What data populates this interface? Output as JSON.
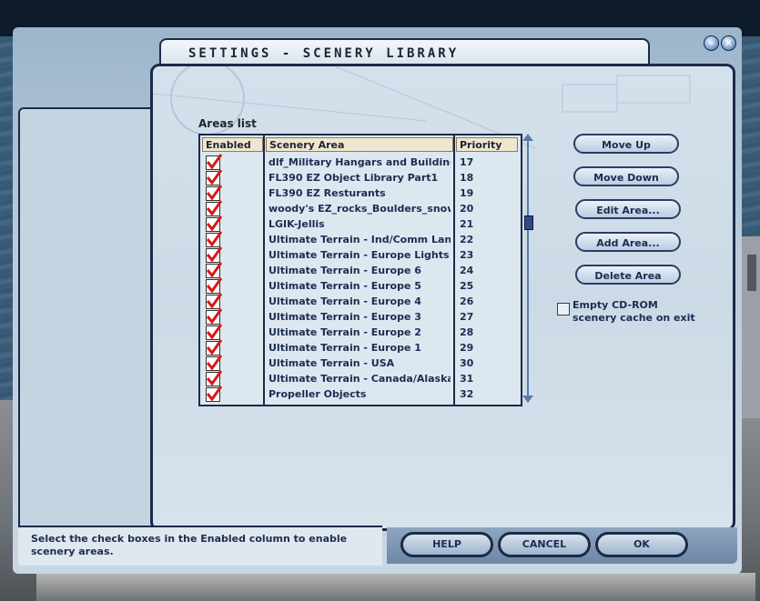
{
  "window": {
    "title": "SETTINGS - SCENERY LIBRARY",
    "minimize_glyph": "–",
    "close_glyph": "✕"
  },
  "areas_list": {
    "label": "Areas list",
    "columns": [
      "Enabled",
      "Scenery Area",
      "Priority"
    ],
    "rows": [
      {
        "enabled": true,
        "name": "dlf_Military Hangars and Buildings Li",
        "priority": "17"
      },
      {
        "enabled": true,
        "name": "FL390 EZ Object Library Part1",
        "priority": "18"
      },
      {
        "enabled": true,
        "name": "FL390 EZ Resturants",
        "priority": "19"
      },
      {
        "enabled": true,
        "name": "woody's EZ_rocks_Boulders_snowc",
        "priority": "20"
      },
      {
        "enabled": true,
        "name": "LGIK-Jellis",
        "priority": "21"
      },
      {
        "enabled": true,
        "name": "Ultimate Terrain - Ind/Comm Landcla",
        "priority": "22"
      },
      {
        "enabled": true,
        "name": "Ultimate Terrain - Europe Lights",
        "priority": "23"
      },
      {
        "enabled": true,
        "name": "Ultimate Terrain - Europe 6",
        "priority": "24"
      },
      {
        "enabled": true,
        "name": "Ultimate Terrain - Europe 5",
        "priority": "25"
      },
      {
        "enabled": true,
        "name": "Ultimate Terrain - Europe 4",
        "priority": "26"
      },
      {
        "enabled": true,
        "name": "Ultimate Terrain - Europe 3",
        "priority": "27"
      },
      {
        "enabled": true,
        "name": "Ultimate Terrain - Europe 2",
        "priority": "28"
      },
      {
        "enabled": true,
        "name": "Ultimate Terrain - Europe 1",
        "priority": "29"
      },
      {
        "enabled": true,
        "name": "Ultimate Terrain - USA",
        "priority": "30"
      },
      {
        "enabled": true,
        "name": "Ultimate Terrain - Canada/Alaska",
        "priority": "31"
      },
      {
        "enabled": true,
        "name": "Propeller Objects",
        "priority": "32"
      }
    ]
  },
  "actions": {
    "move_up": "Move Up",
    "move_down": "Move Down",
    "edit_area": "Edit Area...",
    "add_area": "Add Area...",
    "delete_area": "Delete Area"
  },
  "cd_rom_option": {
    "label": "Empty CD-ROM scenery cache on exit",
    "checked": false
  },
  "status_text": "Select the check boxes in the Enabled column to enable scenery areas.",
  "footer": {
    "help": "HELP",
    "cancel": "CANCEL",
    "ok": "OK"
  },
  "colors": {
    "frame": "#1a2b48",
    "check_red": "#d81818",
    "text": "#1c2c52"
  }
}
